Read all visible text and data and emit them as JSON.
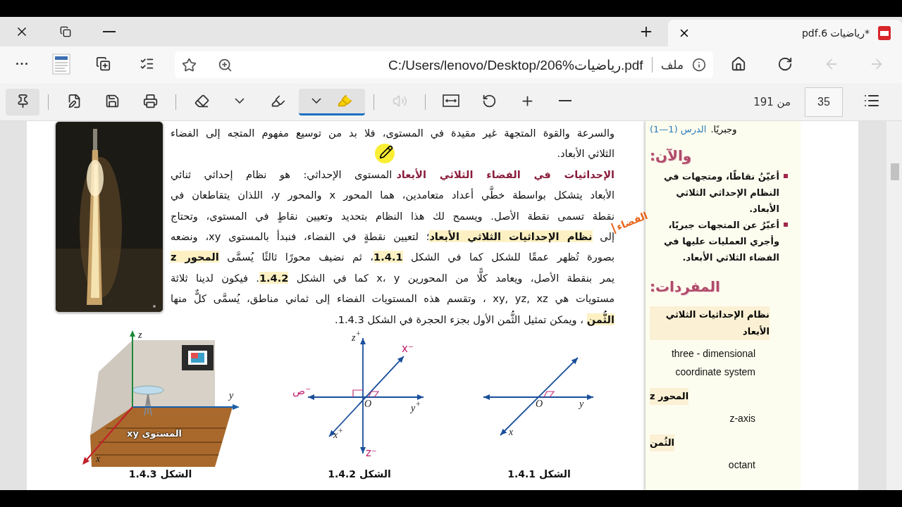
{
  "tab": {
    "title": "*رياضيات 6.pdf",
    "selected": true
  },
  "address_bar": {
    "label": "ملف",
    "url": "C:/Users/lenovo/Desktop/206%رياضيات.pdf"
  },
  "nav": {
    "back_disabled": true,
    "forward_disabled": true
  },
  "toolbar": {
    "tools": [
      {
        "kind": "pin",
        "selected": true,
        "disabled": false
      },
      {
        "kind": "sep"
      },
      {
        "kind": "save-as",
        "selected": false,
        "disabled": false
      },
      {
        "kind": "save",
        "selected": false,
        "disabled": false
      },
      {
        "kind": "print",
        "selected": false,
        "disabled": false
      },
      {
        "kind": "sep"
      },
      {
        "kind": "erase",
        "selected": false,
        "disabled": false
      },
      {
        "kind": "menu",
        "selected": false,
        "disabled": false
      },
      {
        "kind": "highlight",
        "selected": false,
        "disabled": false
      },
      {
        "kind": "pen-menu",
        "selected": true,
        "disabled": false
      },
      {
        "kind": "sep"
      },
      {
        "kind": "read-aloud",
        "selected": false,
        "disabled": true
      },
      {
        "kind": "sep"
      },
      {
        "kind": "fit-width",
        "selected": false,
        "disabled": false
      },
      {
        "kind": "rotate",
        "selected": false,
        "disabled": false
      },
      {
        "kind": "zoom-in",
        "selected": false,
        "disabled": false
      },
      {
        "kind": "zoom-out",
        "selected": false,
        "disabled": false
      }
    ]
  },
  "page_nav": {
    "total": "من 191",
    "current": "35"
  },
  "document": {
    "lines": [
      {
        "kind": "text",
        "text": "والسرعة والقوة المتجهة غير مقيدة في المستوى، فلا بد من توسيع مفهوم المتجه إلى الفضاء"
      },
      {
        "kind": "text",
        "text": "الثلاثي الأبعاد."
      },
      {
        "kind": "heading",
        "heading": "الإحداثيات في الفضاء الثلاثي الأبعاد",
        "text": "المستوى الإحداثي: هو نظام إحداثي ثنائي"
      },
      {
        "kind": "text",
        "text": "الأبعاد يتشكل بواسطة خطَّي أعداد متعامدين، هما المحور x والمحور y، اللذان يتقاطعان في"
      },
      {
        "kind": "text",
        "text": "نقطة تسمى نقطة الأصل. ويسمح لك هذا النظام بتحديد وتعيين نقاطٍ في المستوى، وتحتاج"
      },
      {
        "kind": "text",
        "text": "إلى **نظام الإحداثيات الثلاثي الأبعاد**؛ لتعيين نقطةٍ في الفضاء، فنبدأ بالمستوى xy، ونضعه"
      },
      {
        "kind": "text",
        "text": "بصورة تُظهر عمقًا للشكل كما في الشكل **1.4.1**، ثم نضيف محورًا ثالثًا يُسمَّى **المحور z**"
      },
      {
        "kind": "text",
        "text": "يمر بنقطة الأصل، ويعامد كلًّا من المحورين x، y كما في الشكل **1.4.2**. فيكون لدينا ثلاثة"
      },
      {
        "kind": "text",
        "text": "مستويات هي xy, yz, xz ، وتقسم هذه المستويات الفضاء إلى ثماني مناطق، يُسمَّى كلٌّ منها"
      },
      {
        "kind": "text",
        "text": "**الثُّمن** ، ويمكن تمثيل الثُّمن الأول بجزء الحجرة في الشكل 1.4.3."
      }
    ],
    "annotation": "الفضاء",
    "figures": [
      {
        "kind": "axes2",
        "caption": "الشكل 1.4.1",
        "labels": [
          "O",
          "y",
          "x"
        ]
      },
      {
        "kind": "axes3",
        "caption": "الشكل 1.4.2",
        "labels": [
          "z$^{+}$",
          "y$^{+}$",
          "O",
          "x$^{+}$"
        ],
        "marks": [
          "x⁻",
          "ص⁻",
          "z⁻"
        ]
      },
      {
        "kind": "room",
        "caption": "الشكل 1.4.3",
        "labels": [
          "z",
          "y",
          "x",
          "المستوى xy"
        ]
      }
    ]
  },
  "sidebar": {
    "intro": "وجبريًا.",
    "lesson": "الدرس (1—1)",
    "now_heading": "والآن:",
    "goals": [
      "أعيّنُ نقاطًا، ومتجهات في النظام الإحداثي الثلاثي الأبعاد.",
      "أعبّرُ عن المتجهات جبريًا، وأجري العمليات عليها في الفضاء الثلاثي الأبعاد."
    ],
    "vocab_heading": "المفردات:",
    "vocab": [
      {
        "term": "نظام الإحداثيات الثلاثي الأبعاد",
        "english": "three - dimensional coordinate system"
      },
      {
        "term": "المحور z",
        "english": "z-axis"
      },
      {
        "term": "الثُمن",
        "english": "octant"
      }
    ]
  }
}
